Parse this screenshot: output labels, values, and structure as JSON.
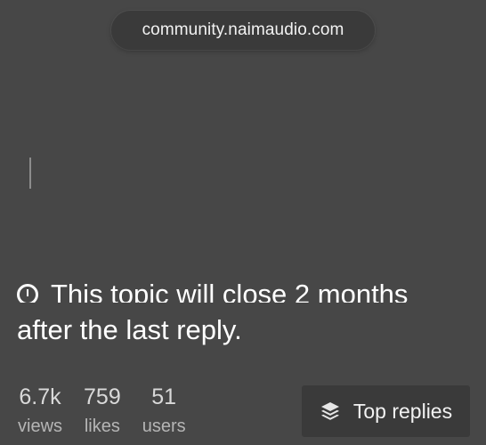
{
  "browser": {
    "url": "community.naimaudio.com"
  },
  "topic_notice": {
    "line1": "This topic will close 2 months",
    "line2": "after the last reply."
  },
  "stats": [
    {
      "value": "6.7k",
      "label": "views"
    },
    {
      "value": "759",
      "label": "likes"
    },
    {
      "value": "51",
      "label": "users"
    }
  ],
  "top_replies": {
    "label": "Top replies",
    "icon": "layers-icon"
  },
  "colors": {
    "background": "#474747",
    "pill_background": "#3a3a3a",
    "text": "#ffffff",
    "muted_text": "#b5b5b5"
  }
}
